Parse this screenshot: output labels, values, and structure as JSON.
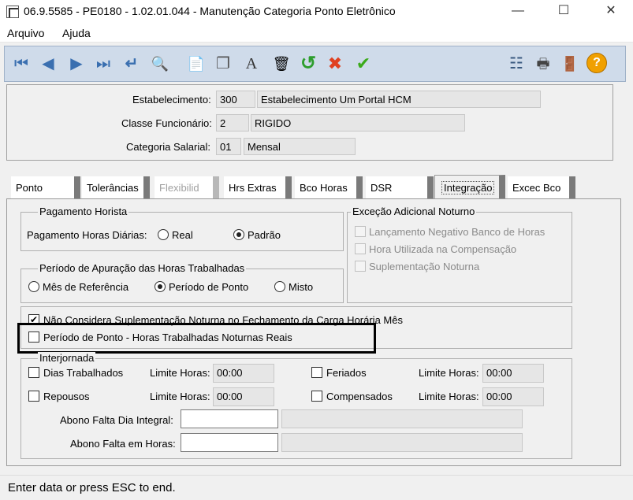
{
  "window": {
    "title": "06.9.5585 - PE0180 - 1.02.01.044 - Manutenção Categoria Ponto Eletrônico",
    "minimize_glyph": "—",
    "maximize_glyph": "☐",
    "close_glyph": "✕"
  },
  "menu": {
    "items": [
      "Arquivo",
      "Ajuda"
    ]
  },
  "toolbar": {
    "icons": {
      "first": "⏮",
      "prev": "◀",
      "next": "▶",
      "last": "⏭",
      "enter": "↵",
      "search": "🔍",
      "new": "📄",
      "copy": "❐",
      "edit": "A",
      "delete": "🗑",
      "undo": "↺",
      "cancel": "✖",
      "confirm": "✔",
      "tree": "☷",
      "print": "🖶",
      "exit": "🚪",
      "help": "?"
    },
    "accent_colors": {
      "undo": "#2e9e2e",
      "cancel": "#e04020",
      "confirm": "#3aaa1a",
      "help": "#f0a000",
      "nav": "#3a6fb0"
    }
  },
  "header": {
    "estabelecimento_label": "Estabelecimento:",
    "estabelecimento_code": "300",
    "estabelecimento_name": "Estabelecimento Um Portal HCM",
    "classe_label": "Classe Funcionário:",
    "classe_code": "2",
    "classe_name": "RIGIDO",
    "categoria_label": "Categoria Salarial:",
    "categoria_code": "01",
    "categoria_name": "Mensal"
  },
  "tabs": [
    {
      "label": "Ponto",
      "state": "normal"
    },
    {
      "label": "Tolerâncias",
      "state": "normal"
    },
    {
      "label": "Flexibilid",
      "state": "disabled"
    },
    {
      "label": "Hrs Extras",
      "state": "normal"
    },
    {
      "label": "Bco Horas",
      "state": "normal"
    },
    {
      "label": "DSR",
      "state": "normal"
    },
    {
      "label": "Integração",
      "state": "active"
    },
    {
      "label": "Excec Bco",
      "state": "normal"
    }
  ],
  "pagamento": {
    "title": "Pagamento Horista",
    "label": "Pagamento Horas Diárias:",
    "option_real": "Real",
    "option_padrao": "Padrão",
    "selected": "Padrão"
  },
  "periodo": {
    "title": "Período de Apuração das Horas Trabalhadas",
    "option_mes": "Mês de Referência",
    "option_ponto": "Período de Ponto",
    "option_misto": "Misto",
    "selected": "Período de Ponto"
  },
  "excecao": {
    "title": "Exceção Adicional Noturno",
    "items": [
      "Lançamento Negativo Banco de Horas",
      "Hora Utilizada na Compensação",
      "Suplementação Noturna"
    ]
  },
  "options": {
    "nao_considera": "Não Considera Suplementação Noturna no Fechamento da Carga Horária Mês",
    "nao_considera_checked": true,
    "periodo_ponto_reais": "Período de Ponto - Horas Trabalhadas Noturnas Reais",
    "periodo_ponto_reais_checked": false
  },
  "interjornada": {
    "title": "Interjornada",
    "dias_trabalhados": "Dias Trabalhados",
    "repousos": "Repousos",
    "feriados": "Feriados",
    "compensados": "Compensados",
    "limite_label": "Limite Horas:",
    "dias_value": "00:00",
    "repousos_value": "00:00",
    "feriados_value": "00:00",
    "compensados_value": "00:00",
    "abono_integral_label": "Abono Falta Dia Integral:",
    "abono_horas_label": "Abono Falta em Horas:"
  },
  "status": {
    "message": "Enter data or press ESC to end."
  }
}
